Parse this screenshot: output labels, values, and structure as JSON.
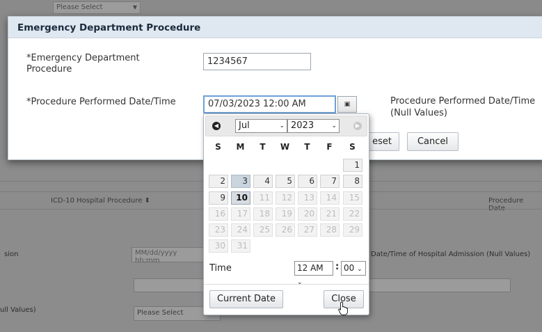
{
  "background": {
    "top_select": "Please Select",
    "grid_headers": [
      "ICD-10 Hospital Procedure ⬍",
      "Procedure Date"
    ],
    "admission_label": "sion",
    "admission_placeholder": "MM/dd/yyyy hh:mm",
    "admission_null_label": "Date/Time of Hospital Admission (Null Values)",
    "null_values_label": "ull Values)",
    "bottom_select": "Please Select"
  },
  "modal": {
    "title": "Emergency Department Procedure",
    "procedure_label_line1": "*Emergency Department",
    "procedure_label_line2": "Procedure",
    "procedure_value": "1234567",
    "date_label": "*Procedure Performed Date/Time",
    "date_value": "07/03/2023 12:00 AM",
    "calendar_icon": "calendar-icon",
    "null_label_line1": "Procedure Performed Date/Time",
    "null_label_line2": "(Null Values)",
    "reset_label": "Reset",
    "reset_visible": "eset",
    "cancel_label": "Cancel"
  },
  "datepicker": {
    "month": "Jul",
    "year": "2023",
    "weekdays": [
      "S",
      "M",
      "T",
      "W",
      "T",
      "F",
      "S"
    ],
    "weeks": [
      [
        "",
        "",
        "",
        "",
        "",
        "",
        "1"
      ],
      [
        "2",
        "3",
        "4",
        "5",
        "6",
        "7",
        "8"
      ],
      [
        "9",
        "10",
        "11",
        "12",
        "13",
        "14",
        "15"
      ],
      [
        "16",
        "17",
        "18",
        "19",
        "20",
        "21",
        "22"
      ],
      [
        "23",
        "24",
        "25",
        "26",
        "27",
        "28",
        "29"
      ],
      [
        "30",
        "31",
        "",
        "",
        "",
        "",
        ""
      ]
    ],
    "selected_day": "3",
    "today": "10",
    "time_label": "Time",
    "hour": "12 AM",
    "minute": "00",
    "current_date_label": "Current Date",
    "close_label": "Close"
  }
}
